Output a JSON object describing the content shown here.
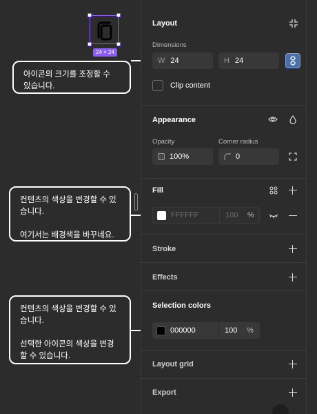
{
  "canvas": {
    "icon_size_label": "24 × 24"
  },
  "callouts": {
    "resize": "아이콘의 크기를 조정할 수\n있습니다.",
    "fill_line1": "컨텐츠의 색상을 변경할 수 있\n습니다.",
    "fill_line2": "여기서는 배경색을 바꾸네요.",
    "selection_line1": "컨텐츠의 색상을 변경할 수 있\n습니다.",
    "selection_line2": "선택한 아이콘의 색상을 변경\n할 수 있습니다."
  },
  "layout": {
    "title": "Layout",
    "dimensions_label": "Dimensions",
    "width_prefix": "W",
    "width_value": "24",
    "height_prefix": "H",
    "height_value": "24",
    "clip_content_label": "Clip content"
  },
  "appearance": {
    "title": "Appearance",
    "opacity_label": "Opacity",
    "opacity_value": "100%",
    "corner_radius_label": "Corner radius",
    "corner_radius_value": "0"
  },
  "fill": {
    "title": "Fill",
    "hex": "FFFFFF",
    "opacity": "100",
    "percent": "%",
    "swatch_color": "#ffffff"
  },
  "stroke": {
    "title": "Stroke"
  },
  "effects": {
    "title": "Effects"
  },
  "selection_colors": {
    "title": "Selection colors",
    "hex": "000000",
    "opacity": "100",
    "percent": "%",
    "swatch_color": "#000000"
  },
  "layout_grid": {
    "title": "Layout grid"
  },
  "export": {
    "title": "Export"
  }
}
